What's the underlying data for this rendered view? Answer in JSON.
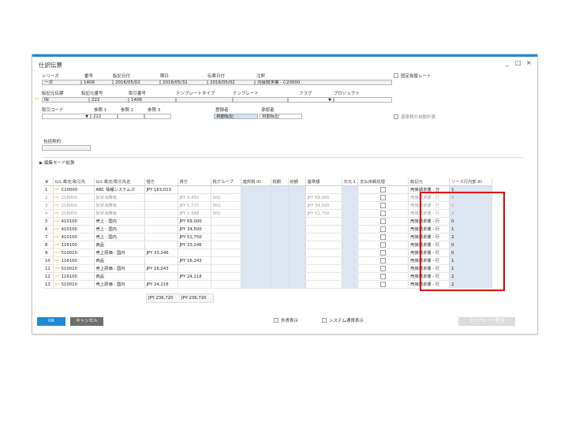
{
  "window": {
    "title": "仕訳伝票",
    "minimize": "_",
    "maximize": "□",
    "close": "×"
  },
  "header": {
    "series_label": "シリーズ",
    "series_value": "一次",
    "number_label": "番号",
    "number_value": "1406",
    "posting_date_label": "転記日付",
    "posting_date_value": "2016/05/02",
    "due_date_label": "期日",
    "due_date_value": "2016/05/31",
    "doc_date_label": "伝票日付",
    "doc_date_value": "2016/05/02",
    "remarks_label": "注釈",
    "remarks_value": "売掛請求書 - C20000",
    "fixed_rate_label": "固定為替レート",
    "origin_type_label": "転記元伝票",
    "origin_type_value": "IN",
    "origin_no_label": "転記元番号",
    "origin_no_value": "222",
    "trans_no_label": "取引番号",
    "trans_no_value": "1406",
    "template_type_label": "テンプレートタイプ",
    "template_label": "テンプレート",
    "flag_label": "フラグ",
    "project_label": "プロジェクト",
    "trans_code_label": "取引コード",
    "ref1_label": "参照 1",
    "ref1_value": "222",
    "ref2_label": "参照 2",
    "ref3_label": "参照 3",
    "registrant_label": "登録者",
    "registrant_value": "自動転記",
    "approver_label": "承認者",
    "approver_value": "自動転記",
    "auto_tax_label": "源泉税の自動計算",
    "contract_label": "包括契約",
    "edit_mode_label": "編集モード拡張"
  },
  "grid": {
    "columns": [
      "#",
      "G/L 勘定/取引先",
      "G/L 勘定/取引先名",
      "借方",
      "貸方",
      "税グループ",
      "連邦税 ID",
      "税額",
      "総額",
      "基準額",
      "次元 1",
      "支払依頼処理",
      "転記元",
      "ソース行内部 ID"
    ],
    "rows": [
      {
        "n": "1",
        "acct": "C20000",
        "name": "ABC 情報システムズ",
        "debit": "JPY 163,013",
        "credit": "",
        "tax": "",
        "base": "",
        "origin": "売掛請求書 - 分",
        "src": "1",
        "gray": false
      },
      {
        "n": "2",
        "acct": "218000",
        "name": "仮受消費税",
        "debit": "",
        "credit": "JPY 3,450",
        "tax": "S01",
        "base": "JPY 69,000",
        "origin": "売掛請求書 - 行",
        "src": "0",
        "gray": true
      },
      {
        "n": "3",
        "acct": "218000",
        "name": "仮受消費税",
        "debit": "",
        "credit": "JPY 1,725",
        "tax": "S01",
        "base": "JPY 34,500",
        "origin": "売掛請求書 - 行",
        "src": "1",
        "gray": true
      },
      {
        "n": "4",
        "acct": "218000",
        "name": "仮受消費税",
        "debit": "",
        "credit": "JPY 2,588",
        "tax": "S01",
        "base": "JPY 51,750",
        "origin": "売掛請求書 - 行",
        "src": "2",
        "gray": true
      },
      {
        "n": "5",
        "acct": "410100",
        "name": "売上 - 国内",
        "debit": "",
        "credit": "JPY 69,000",
        "tax": "",
        "base": "",
        "origin": "売掛請求書 - 行",
        "src": "0",
        "gray": false
      },
      {
        "n": "6",
        "acct": "410100",
        "name": "売上 - 国内",
        "debit": "",
        "credit": "JPY 34,500",
        "tax": "",
        "base": "",
        "origin": "売掛請求書 - 行",
        "src": "1",
        "gray": false
      },
      {
        "n": "7",
        "acct": "410100",
        "name": "売上 - 国内",
        "debit": "",
        "credit": "JPY 51,750",
        "tax": "",
        "base": "",
        "origin": "売掛請求書 - 行",
        "src": "2",
        "gray": false
      },
      {
        "n": "8",
        "acct": "116100",
        "name": "商品",
        "debit": "",
        "credit": "JPY 33,246",
        "tax": "",
        "base": "",
        "origin": "売掛請求書 - 行",
        "src": "0",
        "gray": false
      },
      {
        "n": "9",
        "acct": "510010",
        "name": "売上原価 - 国内",
        "debit": "JPY 33,246",
        "credit": "",
        "tax": "",
        "base": "",
        "origin": "売掛請求書 - 行",
        "src": "0",
        "gray": false
      },
      {
        "n": "10",
        "acct": "116100",
        "name": "商品",
        "debit": "",
        "credit": "JPY 16,243",
        "tax": "",
        "base": "",
        "origin": "売掛請求書 - 行",
        "src": "1",
        "gray": false
      },
      {
        "n": "11",
        "acct": "510010",
        "name": "売上原価 - 国内",
        "debit": "JPY 16,243",
        "credit": "",
        "tax": "",
        "base": "",
        "origin": "売掛請求書 - 行",
        "src": "1",
        "gray": false
      },
      {
        "n": "12",
        "acct": "116100",
        "name": "商品",
        "debit": "",
        "credit": "JPY 24,218",
        "tax": "",
        "base": "",
        "origin": "売掛請求書 - 行",
        "src": "2",
        "gray": false
      },
      {
        "n": "13",
        "acct": "510010",
        "name": "売上原価 - 国内",
        "debit": "JPY 24,218",
        "credit": "",
        "tax": "",
        "base": "",
        "origin": "売掛請求書 - 行",
        "src": "2",
        "gray": false
      }
    ]
  },
  "totals": {
    "debit": "JPY 236,720",
    "credit": "JPY 236,720"
  },
  "footer": {
    "ok": "OK",
    "cancel": "キャンセル",
    "show_fc": "外貨表示",
    "show_sc": "システム通貨表示",
    "template_button": "テンプレート割当"
  },
  "colors": {
    "accent": "#1f8ad4",
    "highlight": "#e20000",
    "gridblue": "#dbe6f2",
    "arrow": "#f0b400"
  }
}
